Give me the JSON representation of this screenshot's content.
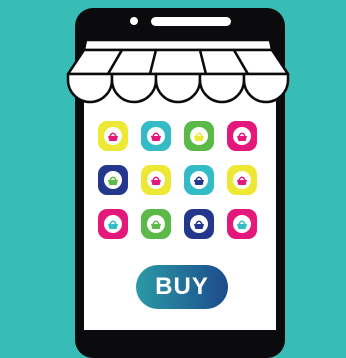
{
  "colors": {
    "background": "#38bdb6",
    "phone_body": "#0b0b0d",
    "screen": "#ffffff",
    "awning_fill": "#ffffff",
    "awning_stroke": "#0b0b0d",
    "button_start": "#2a9aa6",
    "button_end": "#1d4b8c"
  },
  "app_grid": {
    "rows": [
      [
        {
          "icon": "basket-icon",
          "tile": "#ede834",
          "basket": "#e3187a"
        },
        {
          "icon": "basket-icon",
          "tile": "#33bcc8",
          "basket": "#e3187a"
        },
        {
          "icon": "basket-icon",
          "tile": "#5bb947",
          "basket": "#ede834"
        },
        {
          "icon": "basket-icon",
          "tile": "#e3187a",
          "basket": "#e3187a"
        }
      ],
      [
        {
          "icon": "basket-icon",
          "tile": "#23388c",
          "basket": "#5bb947"
        },
        {
          "icon": "basket-icon",
          "tile": "#ede834",
          "basket": "#e3187a"
        },
        {
          "icon": "basket-icon",
          "tile": "#33bcc8",
          "basket": "#23388c"
        },
        {
          "icon": "basket-icon",
          "tile": "#ede834",
          "basket": "#e3187a"
        }
      ],
      [
        {
          "icon": "basket-icon",
          "tile": "#e3187a",
          "basket": "#33bcc8"
        },
        {
          "icon": "basket-icon",
          "tile": "#5bb947",
          "basket": "#5bb947"
        },
        {
          "icon": "basket-icon",
          "tile": "#23388c",
          "basket": "#23388c"
        },
        {
          "icon": "basket-icon",
          "tile": "#e3187a",
          "basket": "#33bcc8"
        }
      ]
    ]
  },
  "buy_button": {
    "label": "BUY"
  }
}
